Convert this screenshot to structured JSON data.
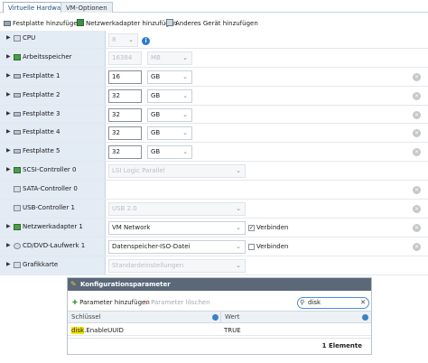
{
  "tabs": [
    {
      "label": "Virtuelle Hardware",
      "active": true
    },
    {
      "label": "VM-Optionen",
      "active": false
    }
  ],
  "toolbar": {
    "add_disk": "Festplatte hinzufügen",
    "add_nic": "Netzwerkadapter hinzufügen",
    "add_other": "Anderes Gerät hinzufügen"
  },
  "hardware": {
    "cpu": {
      "label": "CPU",
      "value": "8"
    },
    "memory": {
      "label": "Arbeitsspeicher",
      "value": "16384",
      "unit": "MB"
    },
    "disk1": {
      "label": "Festplatte 1",
      "value": "16",
      "unit": "GB"
    },
    "disk2": {
      "label": "Festplatte 2",
      "value": "32",
      "unit": "GB"
    },
    "disk3": {
      "label": "Festplatte 3",
      "value": "32",
      "unit": "GB"
    },
    "disk4": {
      "label": "Festplatte 4",
      "value": "32",
      "unit": "GB"
    },
    "disk5": {
      "label": "Festplatte 5",
      "value": "32",
      "unit": "GB"
    },
    "scsi": {
      "label": "SCSI-Controller 0",
      "value": "LSI Logic Parallel"
    },
    "sata": {
      "label": "SATA-Controller 0"
    },
    "usb": {
      "label": "USB-Controller 1",
      "value": "USB 2.0"
    },
    "nic": {
      "label": "Netzwerkadapter 1",
      "value": "VM Network",
      "connect_label": "Verbinden",
      "connected": true
    },
    "cdrom": {
      "label": "CD/DVD-Laufwerk 1",
      "value": "Datenspeicher-ISO-Datei",
      "connect_label": "Verbinden",
      "connected": false
    },
    "gpu": {
      "label": "Grafikkarte",
      "value": "Standardeinstellungen"
    }
  },
  "config": {
    "title": "Konfigurationsparameter",
    "add_param": "Parameter hinzufügen",
    "delete_param": "Parameter löschen",
    "search_value": "disk",
    "columns": [
      "Schlüssel",
      "Wert"
    ],
    "rows": [
      {
        "key_match": "disk",
        "key_rest": ".EnableUUID",
        "value": "TRUE"
      }
    ],
    "count": "1 Elemente"
  },
  "colors": {
    "label_bg": "#e3ebf4",
    "header_bg": "#5a6878",
    "accent": "#2e7bd1",
    "highlight": "#f7e600"
  }
}
